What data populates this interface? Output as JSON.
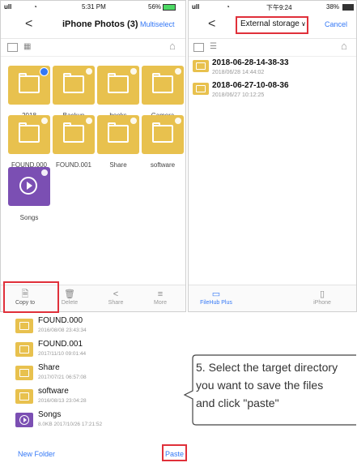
{
  "left_phone": {
    "status": {
      "signal": "ull",
      "time": "5:31 PM",
      "battery": "56%"
    },
    "nav": {
      "back": "<",
      "title": "iPhone Photos (3)",
      "action": "Multiselect"
    },
    "folders": [
      {
        "label": "2018",
        "selected": true
      },
      {
        "label": "Backup",
        "selected": false
      },
      {
        "label": "books",
        "selected": false
      },
      {
        "label": "Camera",
        "selected": false
      },
      {
        "label": "FOUND.000",
        "selected": false
      },
      {
        "label": "FOUND.001",
        "selected": false
      },
      {
        "label": "Share",
        "selected": false
      },
      {
        "label": "software",
        "selected": false
      }
    ],
    "songs_label": "Songs",
    "bottom": [
      {
        "label": "Copy to",
        "icon": "copy-icon"
      },
      {
        "label": "Delete",
        "icon": "trash-icon"
      },
      {
        "label": "Share",
        "icon": "share-icon"
      },
      {
        "label": "More",
        "icon": "menu-icon"
      }
    ]
  },
  "right_phone": {
    "status": {
      "signal": "ull",
      "time": "下午9:24",
      "battery": "38%"
    },
    "nav": {
      "back": "<",
      "title": "External storage",
      "action": "Cancel"
    },
    "rows": [
      {
        "title": "2018-06-28-14-38-33",
        "sub": "2018/06/28 14:44:02"
      },
      {
        "title": "2018-06-27-10-08-36",
        "sub": "2018/06/27 10:12:25"
      }
    ],
    "bottom": [
      {
        "label": "FileHub Plus",
        "icon": "drive-icon"
      },
      {
        "label": "iPhone",
        "icon": "phone-icon"
      }
    ]
  },
  "list": {
    "rows": [
      {
        "title": "FOUND.000",
        "sub": "2016/08/08 23:43:34",
        "type": "folder"
      },
      {
        "title": "FOUND.001",
        "sub": "2017/11/10 09:01:44",
        "type": "folder"
      },
      {
        "title": "Share",
        "sub": "2017/07/21 06:57:08",
        "type": "folder"
      },
      {
        "title": "software",
        "sub": "2016/08/13 23:04:28",
        "type": "folder"
      },
      {
        "title": "Songs",
        "sub": "8.0KB 2017/10/26 17:21:52",
        "type": "video"
      }
    ],
    "new_folder": "New Folder",
    "paste": "Paste"
  },
  "callout": {
    "line1": "5. Select the target directory",
    "line2": "you want to save the files",
    "line3": "and click \"paste\""
  },
  "colors": {
    "accent": "#3478f6",
    "folder": "#e8c14e",
    "video": "#7b4fb3",
    "highlight": "#e0303a"
  }
}
